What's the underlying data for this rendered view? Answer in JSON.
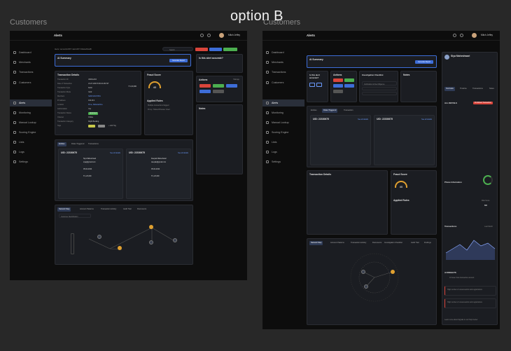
{
  "page": {
    "label_left": "Customers",
    "label_right": "Customers",
    "heading": "option B"
  },
  "colors": {
    "background": "#282828",
    "app_bg": "#0d0d0d",
    "panel_bg": "#1b1d22",
    "accent_blue": "#3d6dd8",
    "danger": "#d9453b",
    "success": "#4caf50",
    "gauge": "#e0a030"
  },
  "left": {
    "topbar": {
      "title": "Alerts",
      "user_name": "Mitch Jeffey"
    },
    "sidebar": {
      "items": [
        {
          "label": "Dashboard",
          "icon": "dashboard-icon"
        },
        {
          "label": "Merchants",
          "icon": "store-icon"
        },
        {
          "label": "Transactions",
          "icon": "transactions-icon"
        },
        {
          "label": "Customers",
          "icon": "users-icon"
        },
        {
          "label": "Alerts",
          "icon": "bell-icon",
          "active": true
        },
        {
          "label": "Monitoring",
          "icon": "monitor-icon"
        },
        {
          "label": "Manual Lookup",
          "icon": "search-icon"
        },
        {
          "label": "Scoring Engine",
          "icon": "engine-icon"
        },
        {
          "label": "Lists",
          "icon": "list-icon"
        },
        {
          "label": "Logs",
          "icon": "log-icon"
        },
        {
          "label": "Settings",
          "icon": "gear-icon"
        }
      ]
    },
    "breadcrumb": "Alerts  /  accountId-9577-4acb-8077-06a0e2b0a4f6",
    "search_placeholder": "Search",
    "ai_summary": {
      "title": "AI Summary",
      "button": "Generate Report"
    },
    "accurate": {
      "title": "Is this alert accurate?"
    },
    "transaction_details": {
      "title": "Transaction Details",
      "rows": [
        {
          "k": "Transaction ID",
          "v": "ASDFe234"
        },
        {
          "k": "Date of Transaction",
          "v": "21-07-2023 8:00:24 AM IST"
        },
        {
          "k": "Transaction Type",
          "v": "Debit"
        },
        {
          "k": "Transaction Mode",
          "v": "Card"
        },
        {
          "k": "Merchant",
          "v": "SADF1234 5531"
        },
        {
          "k": "IP Address",
          "v": "192.20.1"
        },
        {
          "k": "Location",
          "v": "Pune, Maharashtra"
        },
        {
          "k": "Authorization",
          "v": "Yes"
        },
        {
          "k": "Transaction Status",
          "v": "Approved"
        },
        {
          "k": "Channel",
          "v": "Online"
        },
        {
          "k": "Transaction Category",
          "v": "Flight Booking"
        },
        {
          "k": "Tags",
          "v": ""
        }
      ],
      "amount": "₹ 1,00,000",
      "add_tag": "+ Add Tag"
    },
    "fraud_score": {
      "title": "Fraud Score",
      "score": "40",
      "applied_rules_title": "Applied Rules",
      "rules": [
        "Multiple transactions flagged",
        "Proxy / Shared Browser Used"
      ]
    },
    "actions": {
      "title": "Actions",
      "manage": "Manage"
    },
    "notes": {
      "title": "Notes"
    },
    "entities": {
      "tabs": [
        "Entities",
        "Rules Triggered",
        "Transactions"
      ],
      "cards": [
        {
          "uid": "UID: 22330675",
          "link": "See all details",
          "name": "Siya Maheshwari",
          "email": "siya@gmail.com",
          "date": "05-02-2024",
          "amount": "₹ 1,20,000"
        },
        {
          "uid": "UID: 22330675",
          "link": "See all details",
          "name": "Deepak Maheshwari",
          "email": "deepak@gmail.com",
          "date": "05-02-2024",
          "amount": "₹ 1,20,000"
        }
      ]
    },
    "network": {
      "tabs": [
        "Network Map",
        "Account Patterns",
        "Transaction Activity",
        "Audit Trail",
        "Documents"
      ],
      "select": "Customer Identification"
    }
  },
  "right": {
    "topbar": {
      "title": "Alerts",
      "user_name": "Mitch Jeffey"
    },
    "sidebar": {
      "items": [
        {
          "label": "Dashboard",
          "icon": "dashboard-icon"
        },
        {
          "label": "Merchants",
          "icon": "store-icon"
        },
        {
          "label": "Transactions",
          "icon": "transactions-icon"
        },
        {
          "label": "Customers",
          "icon": "users-icon"
        },
        {
          "label": "Alerts",
          "icon": "bell-icon",
          "active": true
        },
        {
          "label": "Monitoring",
          "icon": "monitor-icon"
        },
        {
          "label": "Manual Lookup",
          "icon": "search-icon"
        },
        {
          "label": "Scoring Engine",
          "icon": "engine-icon"
        },
        {
          "label": "Lists",
          "icon": "list-icon"
        },
        {
          "label": "Logs",
          "icon": "log-icon"
        },
        {
          "label": "Settings",
          "icon": "gear-icon"
        }
      ]
    },
    "ai_summary": {
      "title": "AI Summary",
      "button": "Generate Report"
    },
    "accurate_title": "Is this alert accurate?",
    "actions_title": "Actions",
    "checklist_title": "Investigation Checklist",
    "checklist_item": "Verification & Due Diligence",
    "notes_title": "Notes",
    "tabs_mid": [
      "Entities",
      "Rules Triggered",
      "Transaction"
    ],
    "card_uid": "UID: 22330675",
    "card_link": "See all details",
    "transaction_title": "Transaction Details",
    "fraud_title": "Fraud Score",
    "fraud_score": "40",
    "applied_rules": "Applied Rules",
    "network_tabs": [
      "Network Map",
      "Account Patterns",
      "Transaction Activity",
      "Documents",
      "Investigation Checklist",
      "Audit Trail",
      "Findings"
    ],
    "profile": {
      "name": "Siya Maheshwari",
      "tabs": [
        "Overview",
        "Timeline",
        "Transactions",
        "Notes"
      ],
      "all_details": "ALL DETAILS",
      "badge": "Prohibited Transaction",
      "phone_info": "Phone Information",
      "score_label": "Risk Score",
      "score": "800",
      "transactions_title": "Transactions",
      "period": "Last Month",
      "insights_title": "AI INSIGHTS",
      "insights": [
        "10 lower than transaction amount",
        "High number of unsuccessful card registrations",
        "High number of unsuccessful card registrations"
      ],
      "footer": "Learn more about Signals in our  Help Center"
    }
  }
}
